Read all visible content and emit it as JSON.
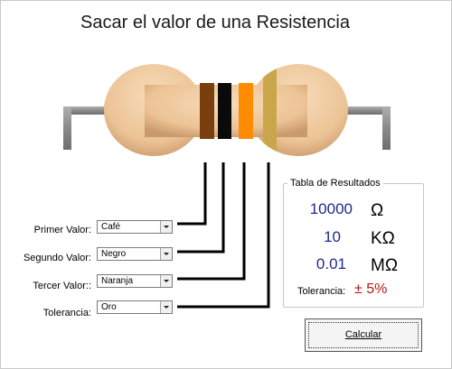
{
  "window": {
    "title": "Sacar el valor de una Resistencia"
  },
  "colors": {
    "band1": "#7a3f0e",
    "band2": "#0a0a0a",
    "band3": "#ff8c00",
    "band4": "#c9a64a",
    "body": "#efc9a0",
    "result_value": "#1c2b8a",
    "tolerance_value": "#b01818"
  },
  "form": {
    "primer": {
      "label": "Primer Valor:",
      "value": "Café"
    },
    "segundo": {
      "label": "Segundo Valor:",
      "value": "Negro"
    },
    "tercer": {
      "label": "Tercer Valor::",
      "value": "Naranja"
    },
    "tolerancia": {
      "label": "Tolerancia:",
      "value": "Oro"
    }
  },
  "results": {
    "title": "Tabla de Resultados",
    "rows": [
      {
        "value": "10000",
        "unit": "Ω"
      },
      {
        "value": "10",
        "unit": "KΩ"
      },
      {
        "value": "0.01",
        "unit": "MΩ"
      }
    ],
    "tolerance_label": "Tolerancia:",
    "tolerance_value": "± 5%"
  },
  "buttons": {
    "calcular": "Calcular"
  }
}
